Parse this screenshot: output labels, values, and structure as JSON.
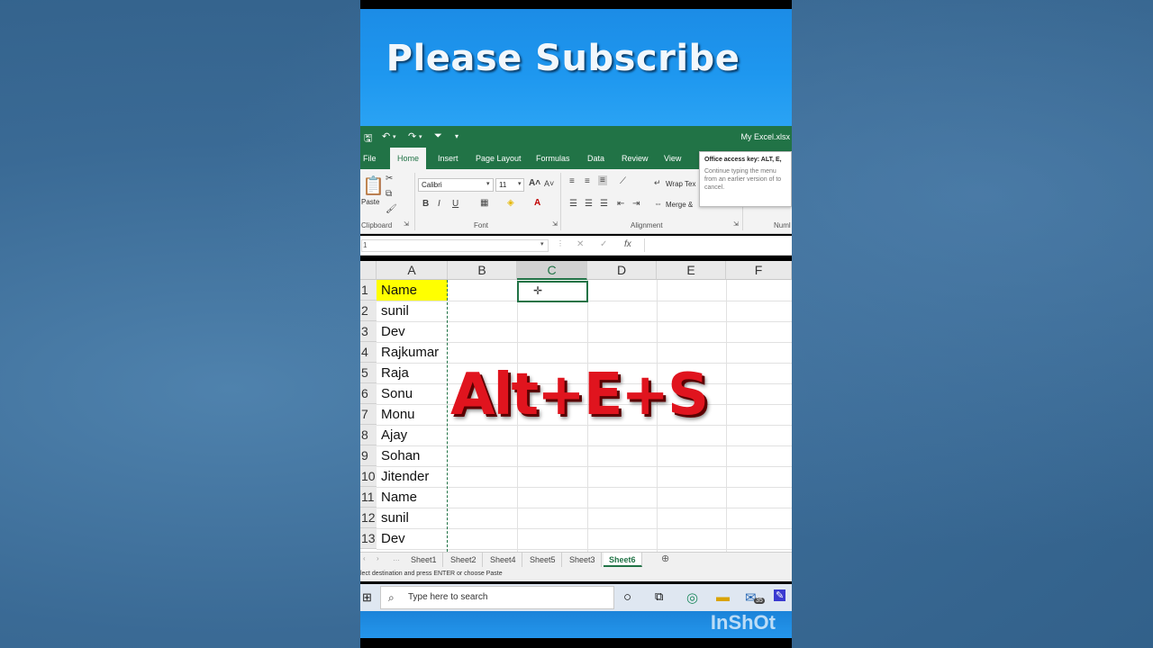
{
  "banner": {
    "title": "Please Subscribe"
  },
  "window": {
    "doc_title": "My Excel.xlsx"
  },
  "ribbon": {
    "tabs": [
      "File",
      "Home",
      "Insert",
      "Page Layout",
      "Formulas",
      "Data",
      "Review",
      "View"
    ],
    "active_tab": "Home",
    "font_name": "Calibri",
    "font_size": "11",
    "paste_label": "Paste",
    "wrap_text": "Wrap Tex",
    "merge": "Merge &",
    "groups": [
      "Clipboard",
      "Font",
      "Alignment",
      "Numl"
    ]
  },
  "tooltip": {
    "title": "Office access key: ALT, E,",
    "body": "Continue typing the menu from an earlier version of to cancel."
  },
  "formula_bar": {
    "name_box": "1",
    "fx": "fx",
    "cancel": "✕",
    "enter": "✓"
  },
  "grid": {
    "columns": [
      "A",
      "B",
      "C",
      "D",
      "E",
      "F"
    ],
    "selected_column": "C",
    "rows": [
      {
        "num": "1",
        "a": "Name",
        "highlight": true
      },
      {
        "num": "2",
        "a": "sunil"
      },
      {
        "num": "3",
        "a": "Dev"
      },
      {
        "num": "4",
        "a": "Rajkumar"
      },
      {
        "num": "5",
        "a": "Raja"
      },
      {
        "num": "6",
        "a": "Sonu"
      },
      {
        "num": "7",
        "a": "Monu"
      },
      {
        "num": "8",
        "a": "Ajay"
      },
      {
        "num": "9",
        "a": "Sohan"
      },
      {
        "num": "10",
        "a": "Jitender"
      },
      {
        "num": "11",
        "a": "Name"
      },
      {
        "num": "12",
        "a": "sunil"
      },
      {
        "num": "13",
        "a": "Dev"
      }
    ]
  },
  "overlay_text": "Alt+E+S",
  "sheets": [
    "Sheet1",
    "Sheet2",
    "Sheet4",
    "Sheet5",
    "Sheet3",
    "Sheet6"
  ],
  "active_sheet": "Sheet6",
  "status_text": "lect destination and press ENTER or choose Paste",
  "taskbar": {
    "search_placeholder": "Type here to search",
    "badge": "35"
  },
  "watermark": "InShOt",
  "colors": {
    "excel_green": "#217346",
    "highlight": "#ffff00",
    "overlay_red": "#e0141e",
    "banner_blue": "#1e97ef"
  }
}
